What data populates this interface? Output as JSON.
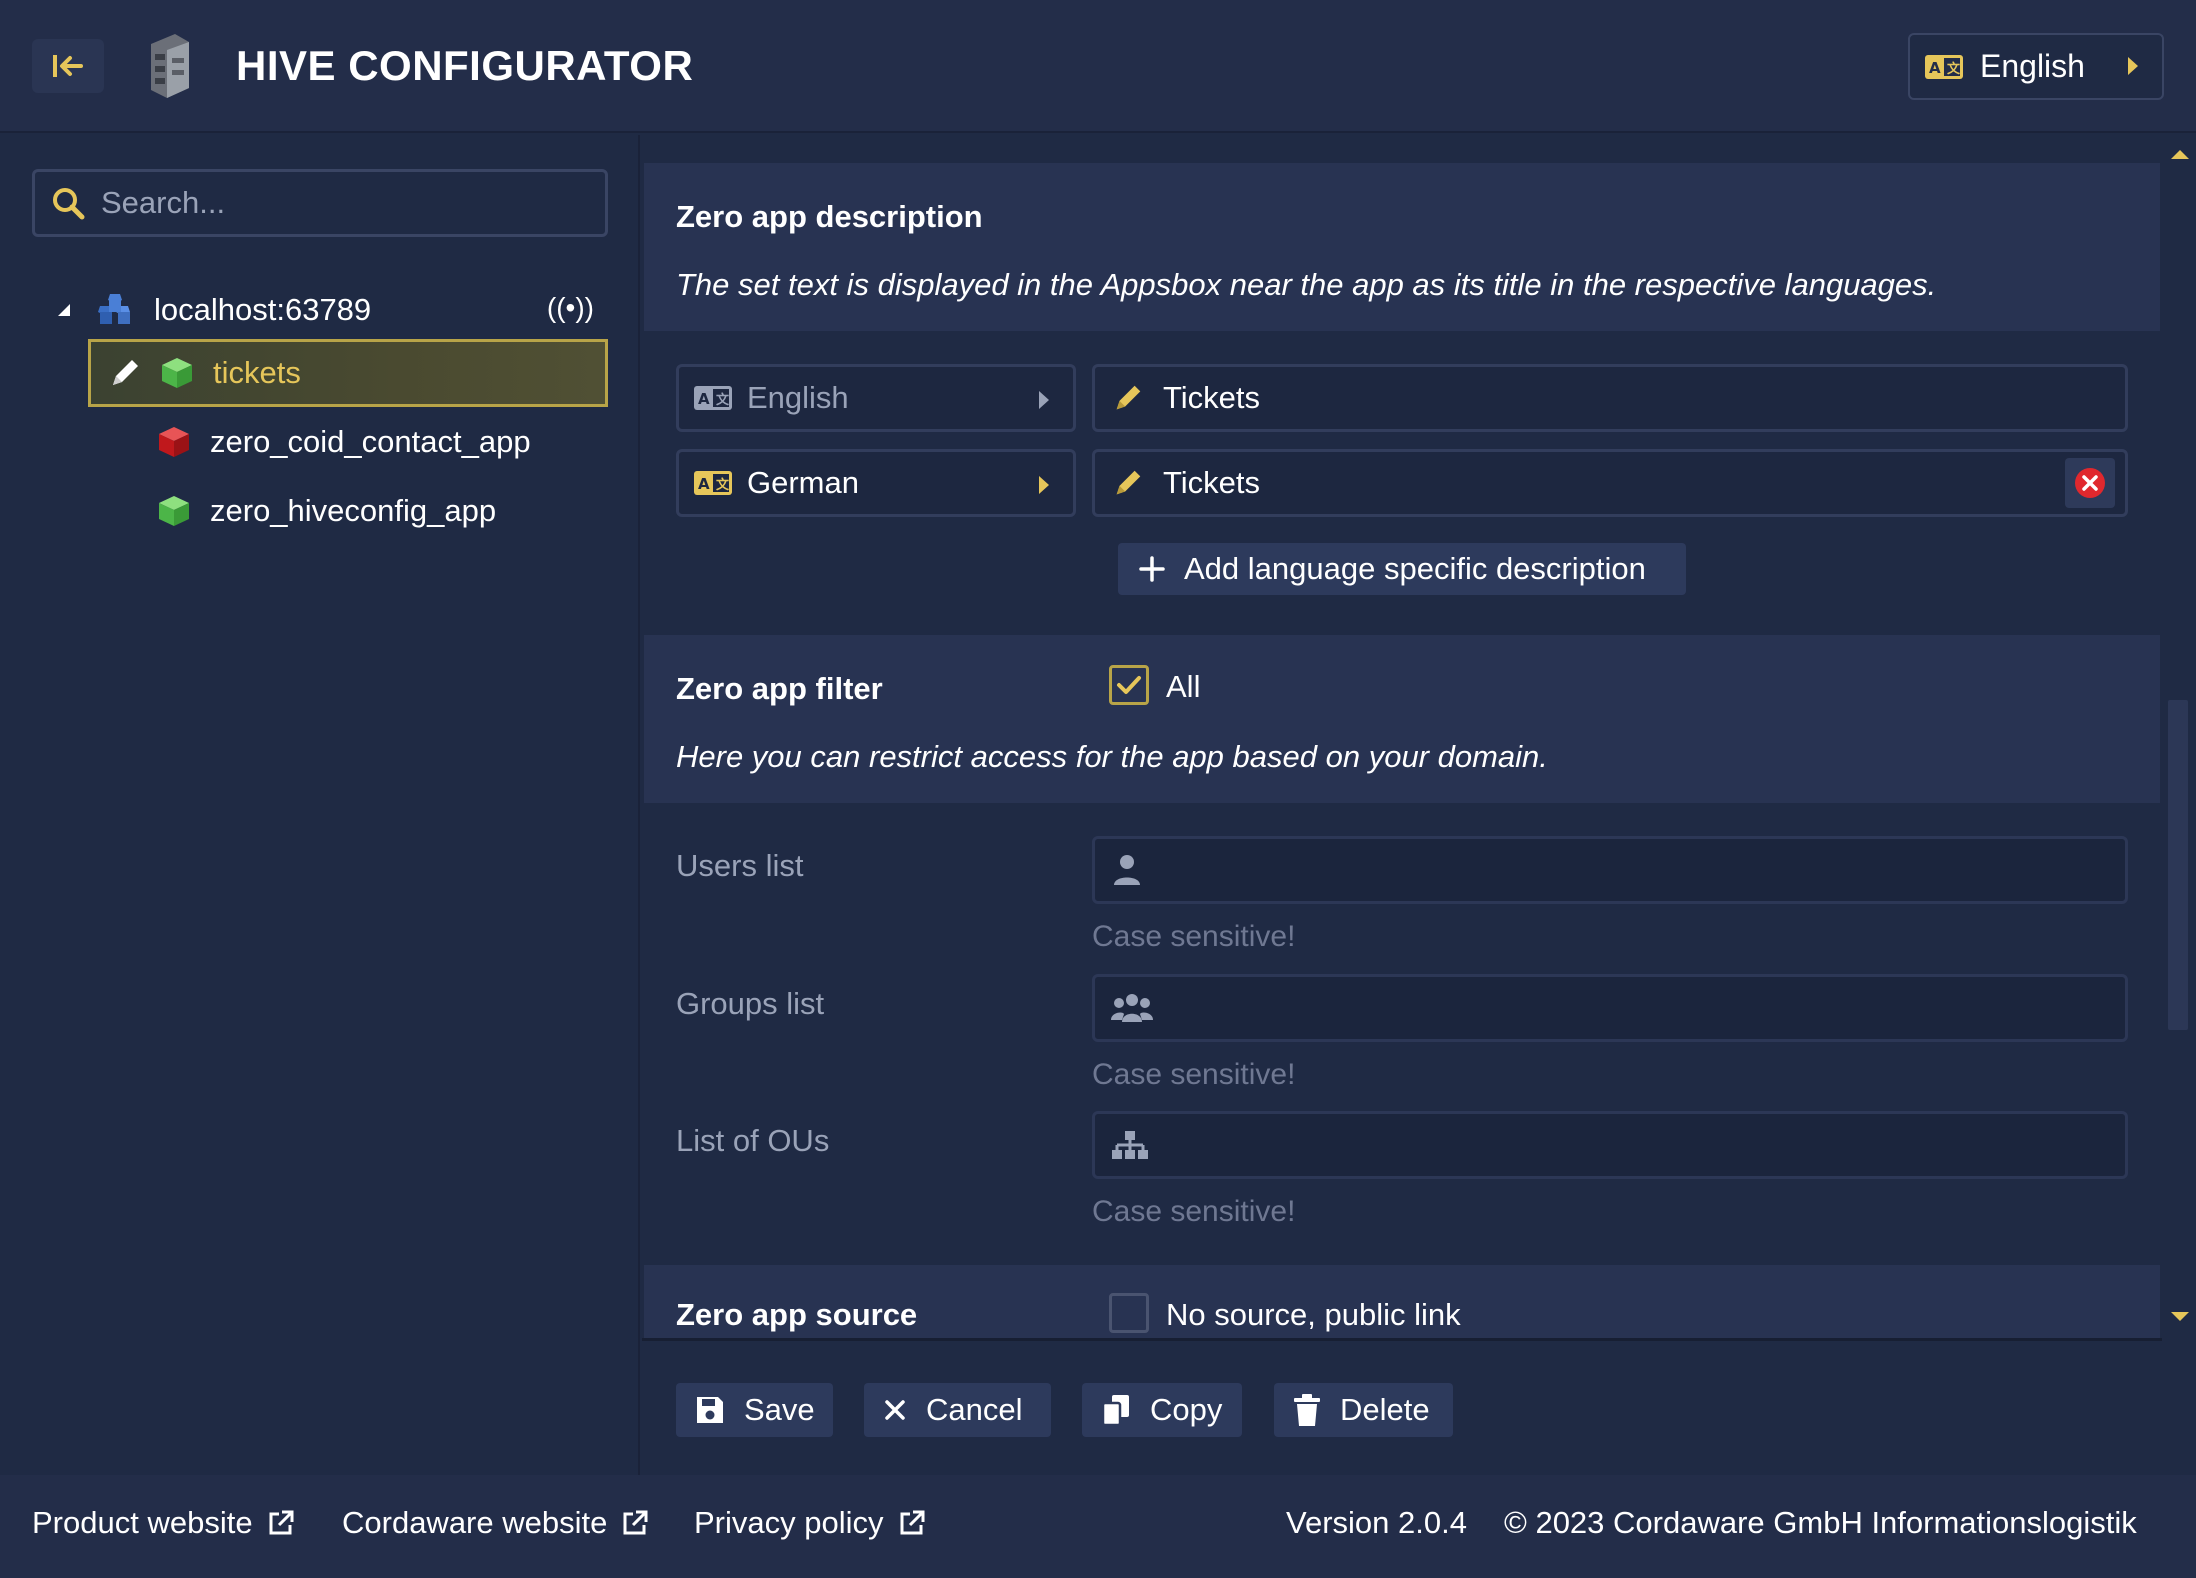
{
  "header": {
    "title": "HIVE CONFIGURATOR",
    "language_label": "English"
  },
  "sidebar": {
    "search_placeholder": "Search...",
    "server": "localhost:63789",
    "apps": [
      {
        "label": "tickets",
        "selected": true,
        "color": "#5cc85a"
      },
      {
        "label": "zero_coid_contact_app",
        "selected": false,
        "color": "#d0282a"
      },
      {
        "label": "zero_hiveconfig_app",
        "selected": false,
        "color": "#5cc85a"
      }
    ]
  },
  "description_section": {
    "title": "Zero app description",
    "desc": "The set text is displayed in the Appsbox near the app as its title in the respective languages.",
    "rows": [
      {
        "language": "English",
        "value": "Tickets"
      },
      {
        "language": "German",
        "value": "Tickets"
      }
    ],
    "add_label": "Add language specific description"
  },
  "filter_section": {
    "title": "Zero app filter",
    "all_label": "All",
    "desc": "Here you can restrict access for the app based on your domain.",
    "users_label": "Users list",
    "groups_label": "Groups list",
    "ous_label": "List of OUs",
    "hint": "Case sensitive!"
  },
  "source_section": {
    "title": "Zero app source",
    "checkbox_label": "No source, public link"
  },
  "actions": {
    "save": "Save",
    "cancel": "Cancel",
    "copy": "Copy",
    "delete": "Delete"
  },
  "footer": {
    "product_website": "Product website",
    "cordaware_website": "Cordaware website",
    "privacy_policy": "Privacy policy",
    "version": "Version 2.0.4",
    "copyright": "© 2023 Cordaware GmbH Informationslogistik"
  },
  "colors": {
    "accent": "#e6c65a",
    "background": "#1f2a44",
    "panel": "#283352",
    "danger": "#e0282e"
  }
}
